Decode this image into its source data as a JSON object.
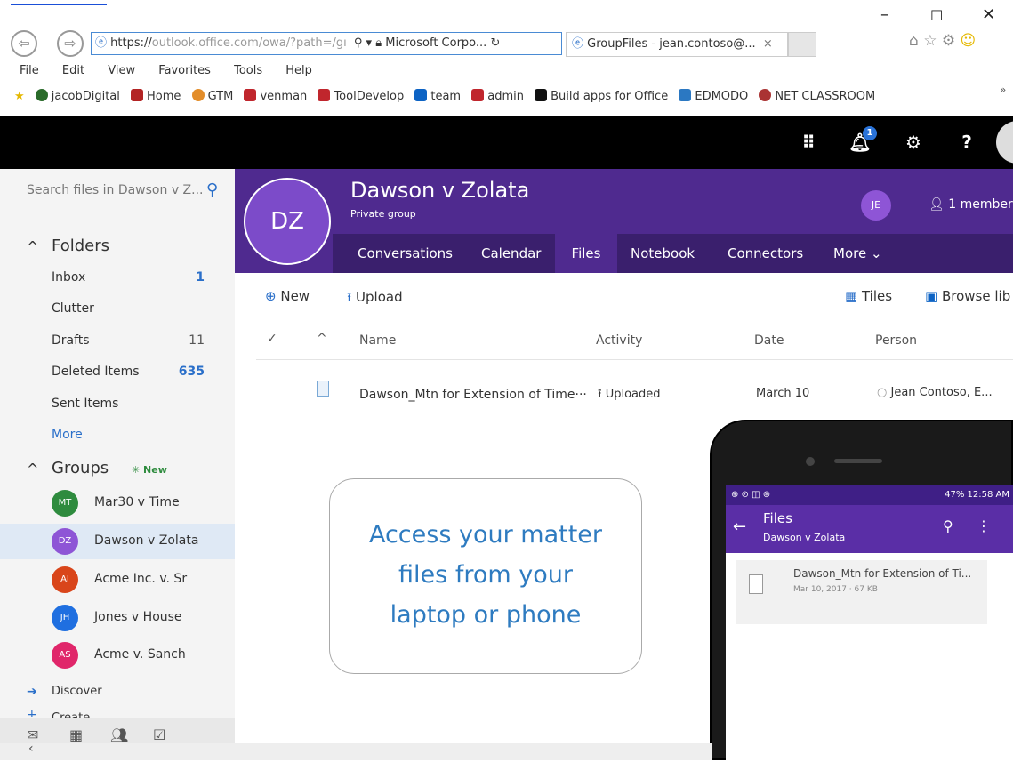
{
  "browser": {
    "address": {
      "prefix": "https://",
      "domain": "outlook.office.com",
      "path": "/owa/?path=/gı"
    },
    "address_site": "Microsoft Corpo...",
    "tab_title": "GroupFiles - jean.contoso@...",
    "menu": [
      "File",
      "Edit",
      "View",
      "Favorites",
      "Tools",
      "Help"
    ],
    "favorites": [
      {
        "label": "jacobDigital",
        "color": "#2a6b2a"
      },
      {
        "label": "Home",
        "color": "#b32424"
      },
      {
        "label": "GTM",
        "color": "#e38d2a"
      },
      {
        "label": "venman",
        "color": "#c0262d"
      },
      {
        "label": "ToolDevelop",
        "color": "#c0262d"
      },
      {
        "label": "team",
        "color": "#0d63c4"
      },
      {
        "label": "admin",
        "color": "#c0262d"
      },
      {
        "label": "Build apps for Office",
        "color": "#111111"
      },
      {
        "label": "EDMODO",
        "color": "#2b78c2"
      },
      {
        "label": "NET CLASSROOM",
        "color": "#a33"
      }
    ],
    "overflow": "»"
  },
  "appbar": {
    "notification_count": "1"
  },
  "search": {
    "placeholder": "Search files in Dawson v Z..."
  },
  "folders": {
    "heading": "Folders",
    "items": [
      {
        "label": "Inbox",
        "count": "1"
      },
      {
        "label": "Clutter",
        "count": ""
      },
      {
        "label": "Drafts",
        "count": "11"
      },
      {
        "label": "Deleted Items",
        "count": "635"
      },
      {
        "label": "Sent Items",
        "count": ""
      },
      {
        "label": "More",
        "count": ""
      }
    ]
  },
  "groups": {
    "heading": "Groups",
    "new_label": "New",
    "items": [
      {
        "initials": "MT",
        "label": "Mar30 v Time",
        "color": "#2e8b3e"
      },
      {
        "initials": "DZ",
        "label": "Dawson v Zolata",
        "color": "#8e55d6"
      },
      {
        "initials": "AI",
        "label": "Acme Inc. v. Sr",
        "color": "#d9451a"
      },
      {
        "initials": "JH",
        "label": "Jones v House",
        "color": "#1f6fe0"
      },
      {
        "initials": "AS",
        "label": "Acme v. Sanch",
        "color": "#e0266a"
      }
    ],
    "discover": "Discover",
    "create": "Create"
  },
  "group_header": {
    "initials": "DZ",
    "name": "Dawson v Zolata",
    "privacy": "Private group",
    "member_initials": "JE",
    "members": "1 member",
    "tabs": [
      "Conversations",
      "Calendar",
      "Files",
      "Notebook",
      "Connectors",
      "More"
    ],
    "active_tab": "Files"
  },
  "toolbar": {
    "new": "New",
    "upload": "Upload",
    "tiles": "Tiles",
    "browse": "Browse lib"
  },
  "columns": {
    "name": "Name",
    "activity": "Activity",
    "date": "Date",
    "person": "Person"
  },
  "file": {
    "name": "Dawson_Mtn for Extension of Time···",
    "activity": "Uploaded",
    "date": "March 10",
    "person": "Jean Contoso, E..."
  },
  "callout": {
    "line1": "Access your matter",
    "line2": "files from your",
    "line3": "laptop or phone"
  },
  "phone": {
    "status": "47% 12:58 AM",
    "title": "Files",
    "subtitle": "Dawson v Zolata",
    "file_name": "Dawson_Mtn for Extension of Ti...",
    "file_meta": "Mar 10, 2017 · 67 KB"
  },
  "colors": {
    "purple": "#4f2a8f",
    "nav_purple": "#3a1f6d",
    "accent_blue": "#2e7bc0"
  }
}
